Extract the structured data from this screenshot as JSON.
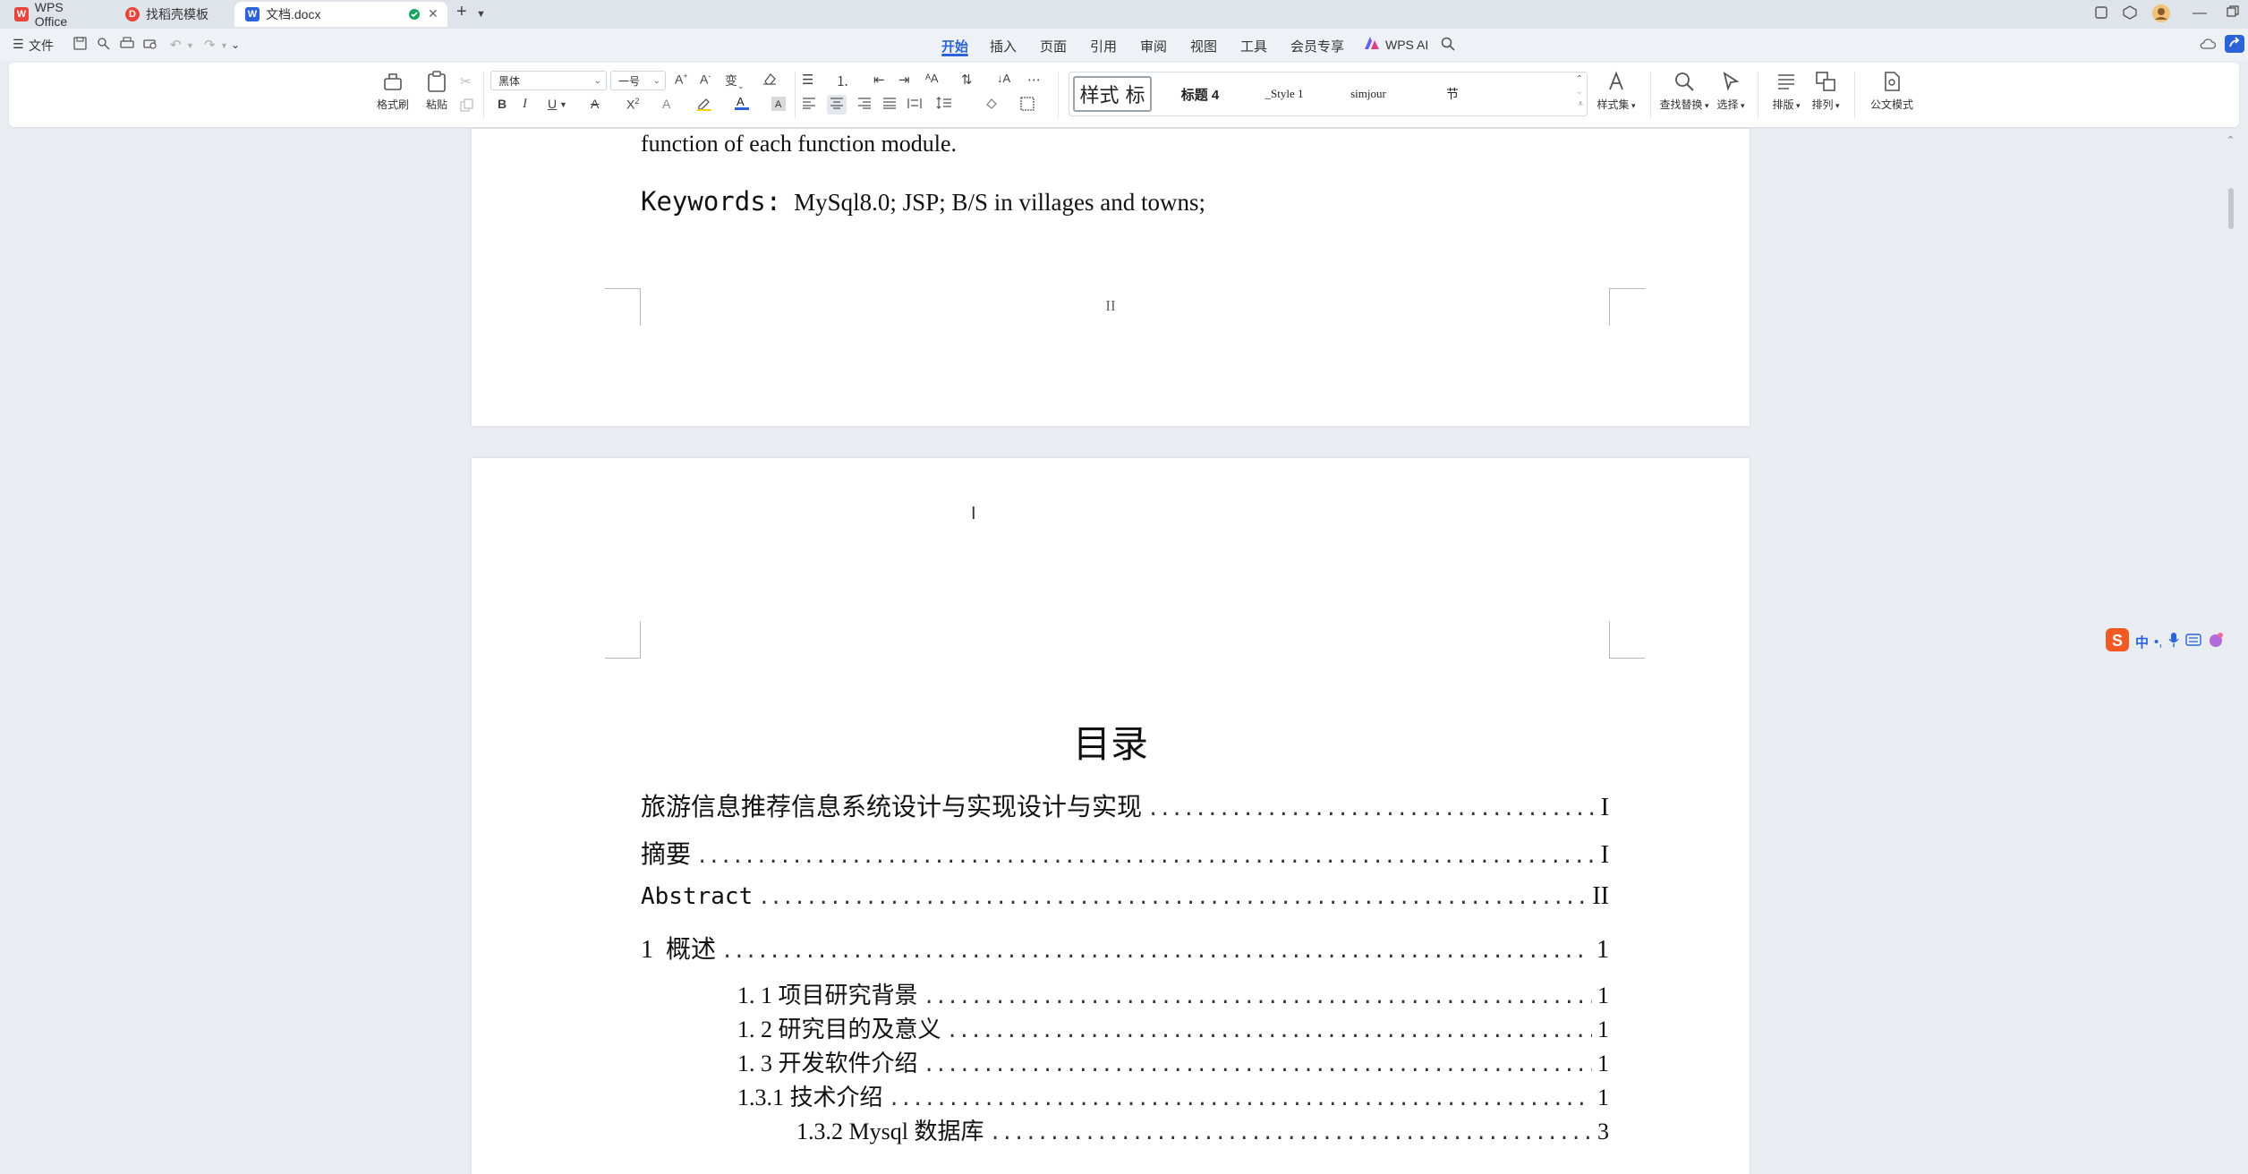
{
  "titlebar": {
    "tabs": [
      {
        "label": "WPS Office",
        "active": false
      },
      {
        "label": "找稻壳模板",
        "active": false
      },
      {
        "label": "文档.docx",
        "active": true
      }
    ]
  },
  "menubar": {
    "file_label": "文件",
    "tabs": [
      "开始",
      "插入",
      "页面",
      "引用",
      "审阅",
      "视图",
      "工具",
      "会员专享"
    ],
    "active_tab": "开始",
    "wps_ai_label": "WPS AI"
  },
  "ribbon": {
    "format_painter": "格式刷",
    "paste": "粘贴",
    "font_name": "黑体",
    "font_size": "一号",
    "styles": [
      "样式 标",
      "标题 4",
      "_Style 1",
      "simjour",
      "节"
    ],
    "style_set": "样式集",
    "find_replace": "查找替换",
    "select": "选择",
    "layout": "排版",
    "arrange": "排列",
    "official_mode": "公文模式"
  },
  "page1": {
    "line_text": "function of each function module.",
    "keywords_label": "Keywords:",
    "keywords_value": "MySql8.0; JSP; B/S in villages and towns;",
    "footer_page_number": "II"
  },
  "page2": {
    "toc_title": "目录",
    "toc": [
      {
        "label": "旅游信息推荐信息系统设计与实现设计与实现",
        "page": "I"
      },
      {
        "label": "摘要",
        "page": "I"
      },
      {
        "label": "Abstract",
        "page": "II"
      },
      {
        "label": "1  概述",
        "page": "1"
      },
      {
        "label": "1. 1 项目研究背景",
        "page": "1"
      },
      {
        "label": "1. 2 研究目的及意义",
        "page": "1"
      },
      {
        "label": "1. 3 开发软件介绍",
        "page": "1"
      },
      {
        "label": "1.3.1 技术介绍",
        "page": "1"
      },
      {
        "label": "1.3.2 Mysql 数据库",
        "page": "3"
      }
    ]
  },
  "ime": {
    "mode": "中"
  },
  "colors": {
    "accent": "#2b63d9",
    "page_bg": "#e9edf2",
    "wps_red": "#e8453c"
  }
}
